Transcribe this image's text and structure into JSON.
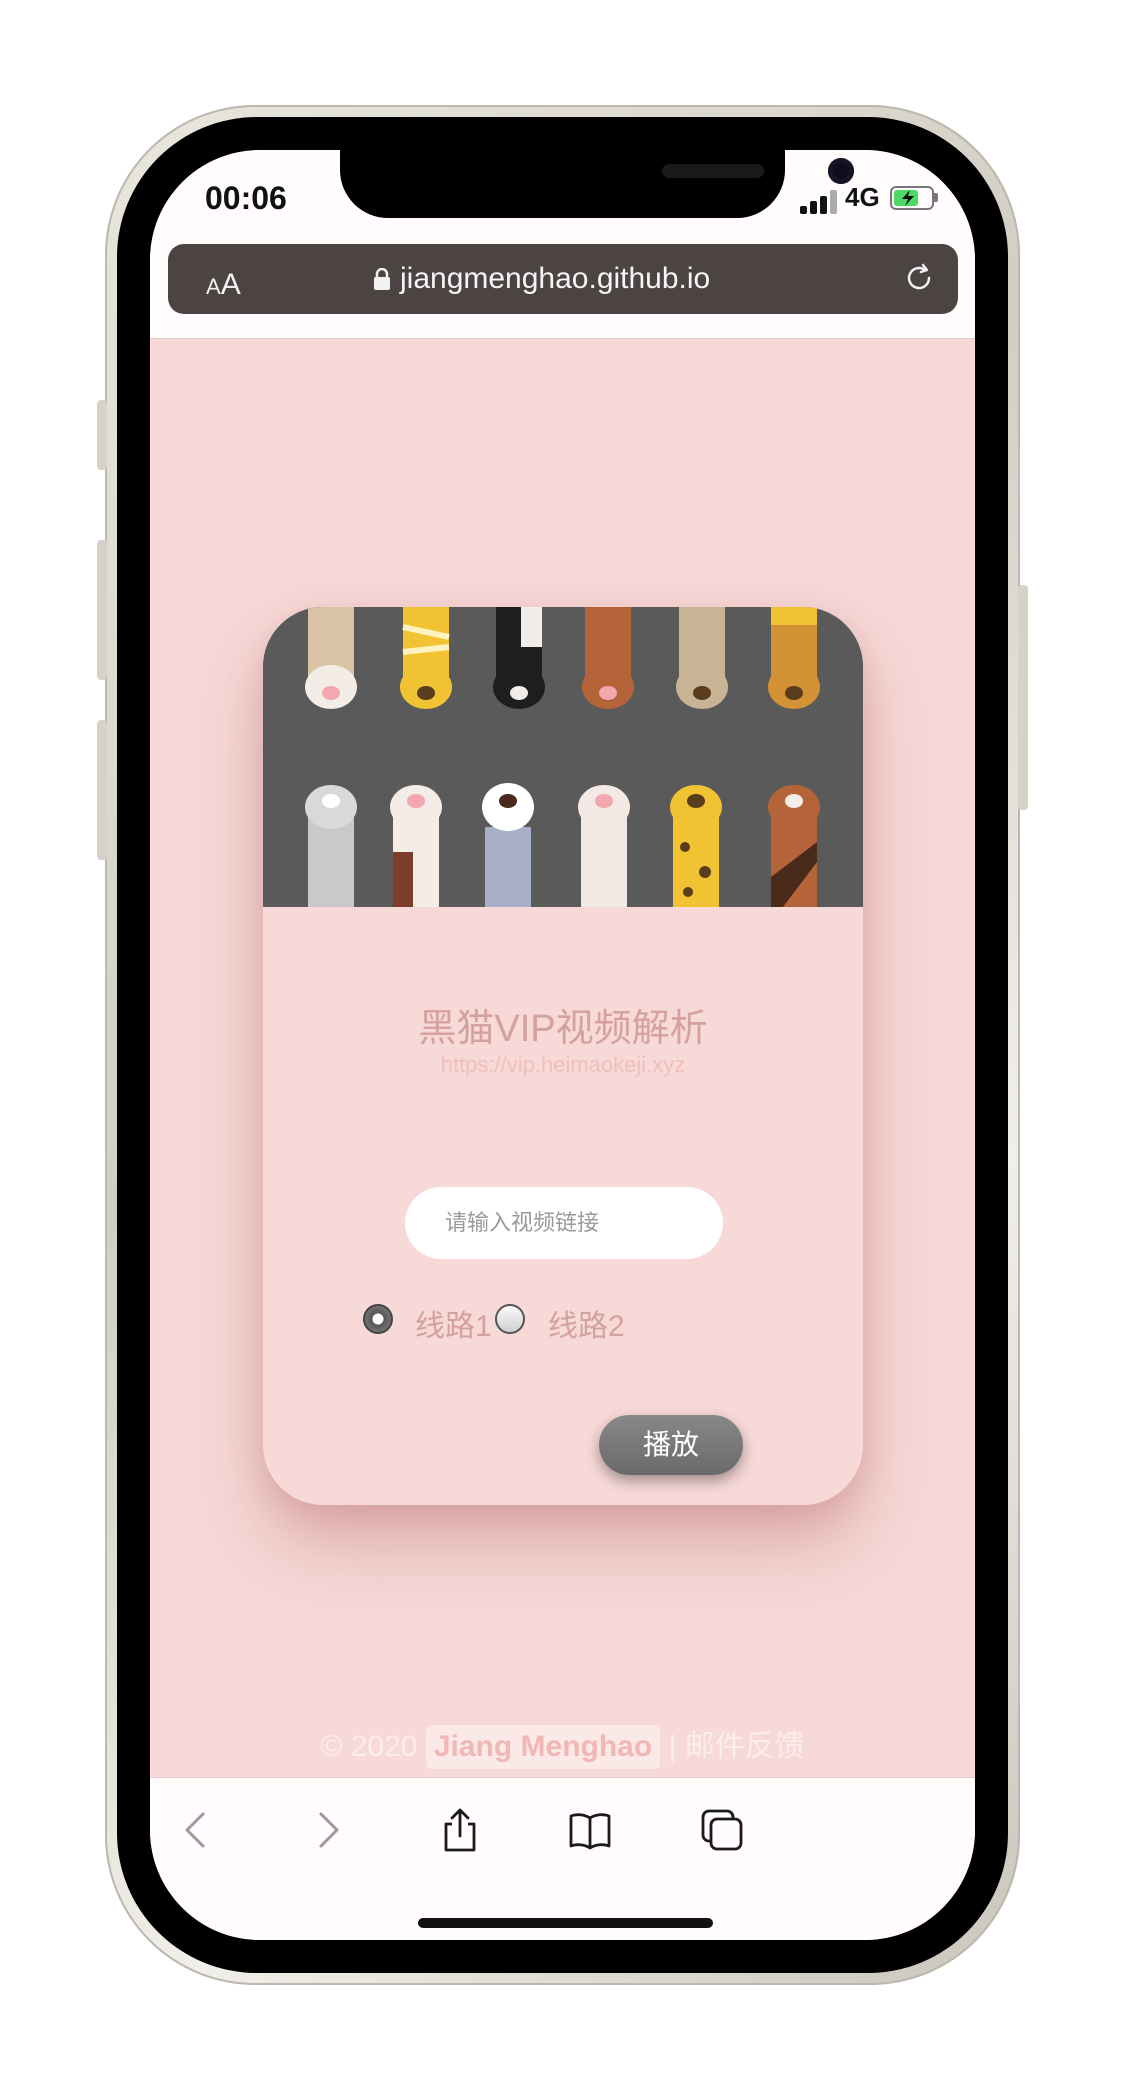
{
  "status_bar": {
    "time": "00:06",
    "network": "4G"
  },
  "browser": {
    "text_size_label_small": "A",
    "text_size_label_large": "A",
    "url": "jiangmenghao.github.io"
  },
  "card": {
    "title": "黑猫VIP视频解析",
    "subtitle": "https://vip.heimaokeji.xyz",
    "input_placeholder": "请输入视频链接",
    "input_value": "",
    "routes": [
      {
        "label": "线路1",
        "selected": true
      },
      {
        "label": "线路2",
        "selected": false
      }
    ],
    "play_label": "播放"
  },
  "footer": {
    "copyright": "© 2020",
    "author": "Jiang Menghao",
    "separator": "|",
    "feedback": "邮件反馈"
  },
  "colors": {
    "page_background": "#f7d9d7",
    "image_background": "#5a5a5a",
    "title_color": "#d4a1a0",
    "button_color": "#777777"
  },
  "icons": {
    "back": "chevron-left-icon",
    "forward": "chevron-right-icon",
    "share": "share-icon",
    "bookmarks": "book-icon",
    "tabs": "tabs-icon",
    "lock": "lock-icon",
    "reload": "reload-icon"
  }
}
